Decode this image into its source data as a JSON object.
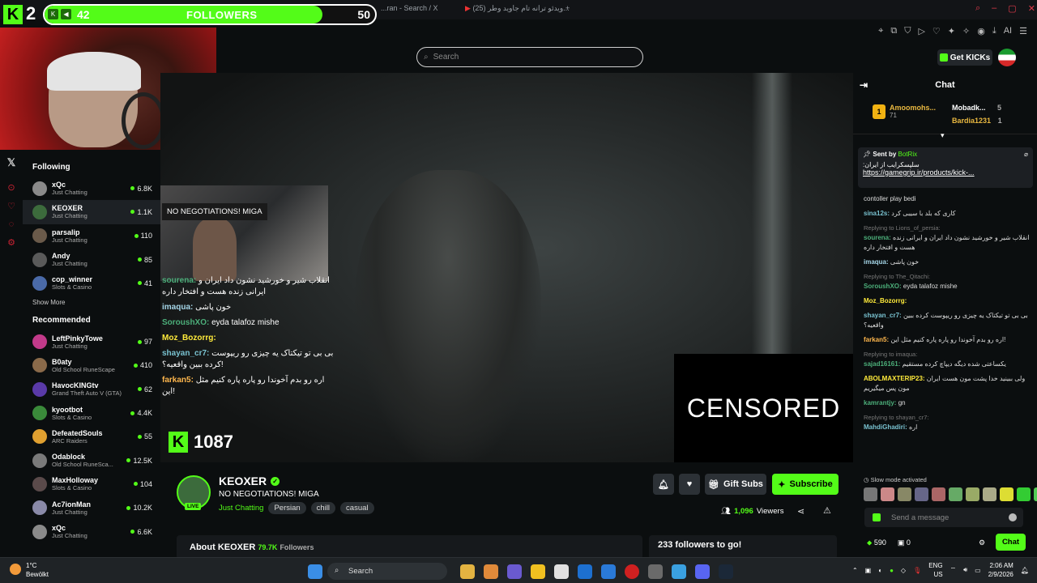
{
  "browser": {
    "tab1": "...ran - Search / X",
    "tab2": "(25) ویدئو ترانه تام جاوید وطر...",
    "new_tab": "+",
    "ai_label": "AI"
  },
  "follower_goal": {
    "current_count": "2",
    "current": "42",
    "label": "FOLLOWERS",
    "goal": "50",
    "progress_percent": 84
  },
  "header": {
    "search_placeholder": "Search",
    "get_kicks_label": "Get KICKs"
  },
  "sidebar": {
    "following_title": "Following",
    "following": [
      {
        "name": "xQc",
        "category": "Just Chatting",
        "viewers": "6.8K",
        "avatar_color": "#8a8a8a"
      },
      {
        "name": "KEOXER",
        "category": "Just Chatting",
        "viewers": "1.1K",
        "avatar_color": "#3c6b3c"
      },
      {
        "name": "parsalip",
        "category": "Just Chatting",
        "viewers": "110",
        "avatar_color": "#6a5a4a"
      },
      {
        "name": "Andy",
        "category": "Just Chatting",
        "viewers": "85",
        "avatar_color": "#5a5a5a"
      },
      {
        "name": "cop_winner",
        "category": "Slots & Casino",
        "viewers": "41",
        "avatar_color": "#4a6aa8"
      }
    ],
    "show_more": "Show More",
    "recommended_title": "Recommended",
    "recommended": [
      {
        "name": "LeftPinkyTowe",
        "category": "Just Chatting",
        "viewers": "97",
        "avatar_color": "#c23a8a"
      },
      {
        "name": "B0aty",
        "category": "Old School RuneScape",
        "viewers": "410",
        "avatar_color": "#8a6a4a"
      },
      {
        "name": "HavocKINGtv",
        "category": "Grand Theft Auto V (GTA)",
        "viewers": "62",
        "avatar_color": "#5a3aa8"
      },
      {
        "name": "kyootbot",
        "category": "Slots & Casino",
        "viewers": "4.4K",
        "avatar_color": "#3a8a3a"
      },
      {
        "name": "DefeatedSouls",
        "category": "ARC Raiders",
        "viewers": "55",
        "avatar_color": "#e0a030"
      },
      {
        "name": "Odablock",
        "category": "Old School RuneSca...",
        "viewers": "12.5K",
        "avatar_color": "#7a7a7a"
      },
      {
        "name": "MaxHolloway",
        "category": "Slots & Casino",
        "viewers": "104",
        "avatar_color": "#5a4a4a"
      },
      {
        "name": "Ac7ionMan",
        "category": "Just Chatting",
        "viewers": "10.2K",
        "avatar_color": "#8a8aa8"
      },
      {
        "name": "xQc",
        "category": "Just Chatting",
        "viewers": "6.6K",
        "avatar_color": "#8a8a8a"
      }
    ]
  },
  "video": {
    "banner": "NO NEGOTIATIONS! MIGA",
    "censored_label": "CENSORED",
    "kick_count": "1087",
    "overlay_chat": [
      {
        "user": "sourena:",
        "text": "انقلاب شیر و خورشید نشون داد ایران و ایرانی زنده هست و افتخار داره",
        "color": "#4caf7a"
      },
      {
        "user": "imaqua:",
        "text": "خون پاشی",
        "color": "#a5d6e8"
      },
      {
        "user": "SoroushXO:",
        "text": "eyda talafoz mishe",
        "color": "#4caf7a"
      },
      {
        "user": "Moz_Bozorrg:",
        "text": "",
        "color": "#ffeb3b"
      },
      {
        "user": "shayan_cr7:",
        "text": "بی بی تو تیکتاک یه چیزی رو ریپوست کرده ببین واقعیه؟!",
        "color": "#79c2d0"
      },
      {
        "user": "farkan5:",
        "text": "اره رو بدم آخوندا رو پاره پاره کنیم مثل این!",
        "color": "#ffb74d"
      }
    ]
  },
  "stream": {
    "name": "KEOXER",
    "title": "NO NEGOTIATIONS! MIGA",
    "category": "Just Chatting",
    "tags": [
      "Persian",
      "chill",
      "casual"
    ],
    "live_label": "LIVE",
    "gift_subs": "Gift Subs",
    "subscribe": "Subscribe",
    "viewers_count": "1,096",
    "viewers_label": "Viewers",
    "about_label": "About KEOXER",
    "followers_count": "79.7K",
    "followers_label": "Followers",
    "goal_text": "233 followers to go!"
  },
  "chat": {
    "title": "Chat",
    "leaderboard": [
      {
        "rank": "1",
        "name": "Amoomohs...",
        "score": "71"
      },
      {
        "name": "Mobadk...",
        "score": "5"
      },
      {
        "name": "Bardia1231",
        "score": "1"
      }
    ],
    "pinned": {
      "sent_by": "Sent by",
      "bot": "BotRix",
      "message": "سلپسکرایب از ایران:",
      "link": "https://gamegrip.ir/products/kick-..."
    },
    "messages": [
      {
        "reply": "",
        "user": "",
        "text": "contoller play bedi",
        "color": "#ddd"
      },
      {
        "reply": "",
        "user": "sina12s:",
        "text": "کاری که بلد با سیبی کرد",
        "color": "#79c2d0"
      },
      {
        "reply": "Replying to Lions_of_persia:",
        "user": "sourena:",
        "text": "انقلاب شیر و خورشید نشون داد ایران و ایرانی زنده هست و افتخار داره",
        "color": "#4caf7a"
      },
      {
        "reply": "",
        "user": "imaqua:",
        "text": "خون پاشی",
        "color": "#a5d6e8"
      },
      {
        "reply": "Replying to The_Qitachi:",
        "user": "SoroushXO:",
        "text": "eyda talafoz mishe",
        "color": "#4caf7a"
      },
      {
        "reply": "",
        "user": "Moz_Bozorrg:",
        "text": "",
        "color": "#ffeb3b"
      },
      {
        "reply": "",
        "user": "shayan_cr7:",
        "text": "بی بی تو تیکتاک یه چیزی رو ریپوست کرده ببین واقعیه؟",
        "color": "#79c2d0"
      },
      {
        "reply": "",
        "user": "farkan5:",
        "text": "اره رو بدم آخوندا رو پاره پاره کنیم مثل این!",
        "color": "#ffb74d"
      },
      {
        "reply": "Replying to imaqua:",
        "user": "sajad16161:",
        "text": "یکساعتی شده دیگه دیپاچ کرده مستقیم",
        "color": "#4caf7a"
      },
      {
        "reply": "",
        "user": "ABOLMAXTERIP23:",
        "text": "ولی ببینید خدا پشت مون هست ایران مون پس میگیریم",
        "color": "#ffeb3b"
      },
      {
        "reply": "",
        "user": "kamrantjy:",
        "text": "gn",
        "color": "#4caf7a"
      },
      {
        "reply": "Replying to shayan_cr7:",
        "user": "MahdiGhadiri:",
        "text": "اره",
        "color": "#79c2d0"
      }
    ],
    "slow_mode": "Slow mode activated",
    "send_placeholder": "Send a message",
    "points": "590",
    "claim_count": "0",
    "chat_button": "Chat"
  },
  "taskbar": {
    "temp": "1°C",
    "weather": "Bewölkt",
    "search_label": "Search",
    "lang1": "ENG",
    "lang2": "US",
    "time": "2:06 AM",
    "date": "2/9/2026"
  }
}
